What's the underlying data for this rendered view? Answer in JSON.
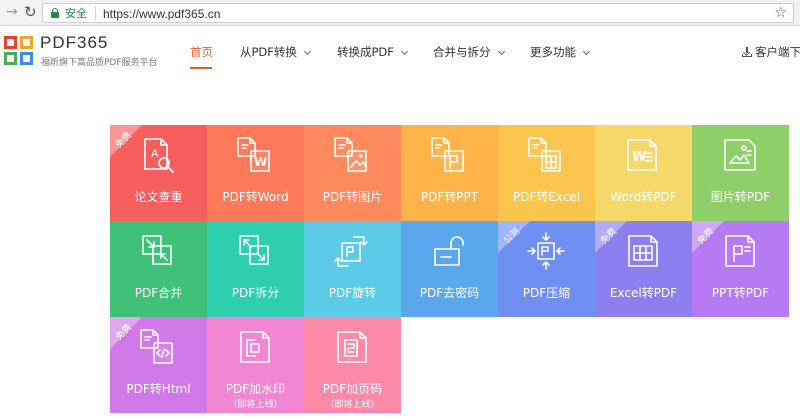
{
  "browser": {
    "secure_label": "安全",
    "url": "https://www.pdf365.cn"
  },
  "header": {
    "brand": "PDF365",
    "slogan": "福昕旗下高品质PDF服务平台",
    "nav": [
      {
        "label": "首页",
        "active": true
      },
      {
        "label": "从PDF转换"
      },
      {
        "label": "转换成PDF"
      },
      {
        "label": "合并与拆分"
      },
      {
        "label": "更多功能"
      }
    ],
    "client_label": "客户端下"
  },
  "colors": {
    "accent": "#e25d33",
    "logo": [
      "#e8412c",
      "#f5a623",
      "#4caf50",
      "#3a8ee6"
    ]
  },
  "tiles": [
    {
      "label": "论文查重",
      "badge": "免费",
      "color": "#f75f5f",
      "icon": "paper-check-icon"
    },
    {
      "label": "PDF转Word",
      "color": "#ff7a5a",
      "icon": "pdf-to-word-icon"
    },
    {
      "label": "PDF转图片",
      "color": "#ff8a5e",
      "icon": "pdf-to-image-icon"
    },
    {
      "label": "PDF转PPT",
      "color": "#ffb44a",
      "icon": "pdf-to-ppt-icon"
    },
    {
      "label": "PDF转Excel",
      "color": "#fcc54d",
      "icon": "pdf-to-excel-icon"
    },
    {
      "label": "Word转PDF",
      "color": "#f4d96a",
      "icon": "word-to-pdf-icon"
    },
    {
      "label": "图片转PDF",
      "color": "#8fcf6a",
      "icon": "image-to-pdf-icon"
    },
    {
      "label": "PDF合并",
      "color": "#3fc17a",
      "icon": "pdf-merge-icon"
    },
    {
      "label": "PDF拆分",
      "color": "#2ecfae",
      "icon": "pdf-split-icon"
    },
    {
      "label": "PDF旋转",
      "color": "#5ccbe8",
      "icon": "pdf-rotate-icon"
    },
    {
      "label": "PDF去密码",
      "color": "#5aa7ee",
      "icon": "pdf-unlock-icon"
    },
    {
      "label": "PDF压缩",
      "badge": "公测",
      "color": "#6f8ff2",
      "icon": "pdf-compress-icon"
    },
    {
      "label": "Excel转PDF",
      "badge": "免费",
      "color": "#8d7ff0",
      "icon": "excel-to-pdf-icon"
    },
    {
      "label": "PPT转PDF",
      "badge": "免费",
      "color": "#b67af2",
      "icon": "ppt-to-pdf-icon"
    },
    {
      "label": "PDF转Html",
      "badge": "免费",
      "color": "#d079e8",
      "icon": "pdf-to-html-icon"
    },
    {
      "label": "PDF加水印",
      "sub": "（即将上线）",
      "color": "#f286d2",
      "icon": "pdf-watermark-icon"
    },
    {
      "label": "PDF加页码",
      "sub": "（即将上线）",
      "color": "#fb8aa9",
      "icon": "pdf-page-number-icon"
    }
  ]
}
